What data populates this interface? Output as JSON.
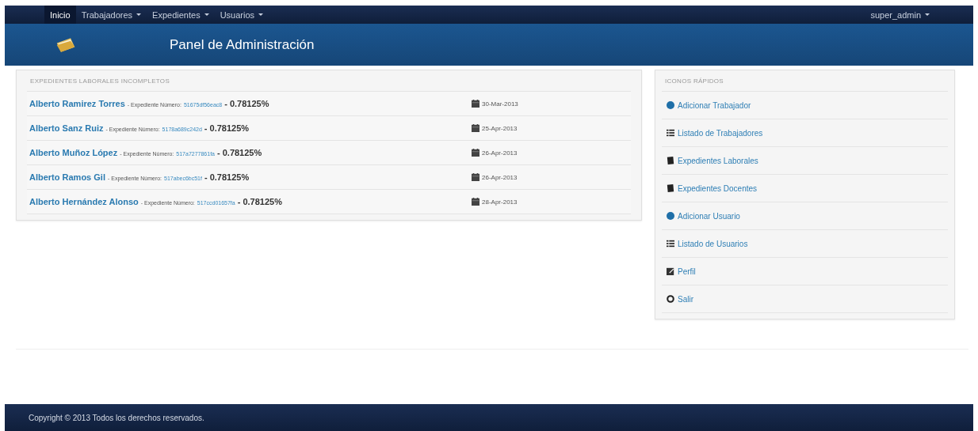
{
  "nav": {
    "items": [
      {
        "label": "Inicio",
        "selected": true,
        "dropdown": false
      },
      {
        "label": "Trabajadores",
        "selected": false,
        "dropdown": true
      },
      {
        "label": "Expedientes",
        "selected": false,
        "dropdown": true
      },
      {
        "label": "Usuarios",
        "selected": false,
        "dropdown": true
      }
    ],
    "user": {
      "label": "super_admin",
      "dropdown": true
    }
  },
  "header": {
    "title": "Panel de Administración"
  },
  "records": {
    "title": "EXPEDIENTES LABORALES INCOMPLETOS",
    "rows": [
      {
        "name": "Alberto Ramirez Torres",
        "label": "- Expediente Número:",
        "number": "51675df56eac8",
        "percent": "- 0.78125%",
        "date": "30-Mar-2013"
      },
      {
        "name": "Alberto Sanz Ruiz",
        "label": "- Expediente Número:",
        "number": "5178a689c242d",
        "percent": "- 0.78125%",
        "date": "25-Apr-2013"
      },
      {
        "name": "Alberto Muñoz López",
        "label": "- Expediente Número:",
        "number": "517a7277861fa",
        "percent": "- 0.78125%",
        "date": "26-Apr-2013"
      },
      {
        "name": "Alberto Ramos Gil",
        "label": "- Expediente Número:",
        "number": "517abec6bc51f",
        "percent": "- 0.78125%",
        "date": "26-Apr-2013"
      },
      {
        "name": "Alberto Hernández Alonso",
        "label": "- Expediente Número:",
        "number": "517ccd01657fa",
        "percent": "- 0.78125%",
        "date": "28-Apr-2013"
      }
    ]
  },
  "quick_links": {
    "title": "ICONOS RÁPIDOS",
    "items": [
      {
        "label": "Adicionar Trabajador",
        "kind": "add"
      },
      {
        "label": "Listado de Trabajadores",
        "kind": "list"
      },
      {
        "label": "Expedientes Laborales",
        "kind": "book"
      },
      {
        "label": "Expedientes Docentes",
        "kind": "book"
      },
      {
        "label": "Adicionar Usuario",
        "kind": "add"
      },
      {
        "label": "Listado de Usuarios",
        "kind": "list"
      },
      {
        "label": "Perfil",
        "kind": "edit"
      },
      {
        "label": "Salir",
        "kind": "off"
      }
    ]
  },
  "footer": {
    "text": "Copyright © 2013 Todos los derechos reservados."
  }
}
